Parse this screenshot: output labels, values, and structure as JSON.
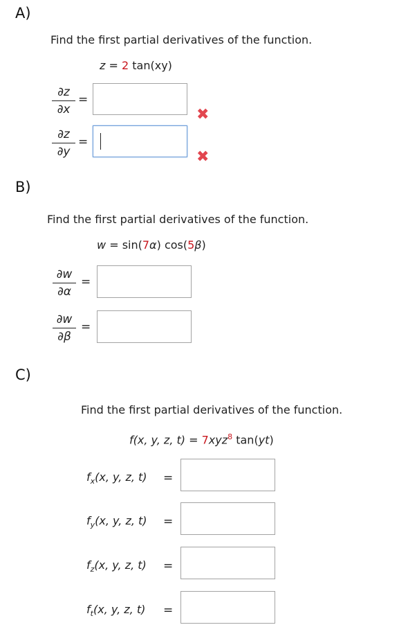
{
  "sectionA": {
    "label": "A)",
    "instruction": "Find the first partial derivatives of the function.",
    "formula": {
      "lhs": "z",
      "eq": "=",
      "coef": "2",
      "rest": "tan(xy)"
    },
    "rows": [
      {
        "num": "∂z",
        "den": "∂x",
        "eq": "=",
        "value": "",
        "status_icon": "cross-icon"
      },
      {
        "num": "∂z",
        "den": "∂y",
        "eq": "=",
        "value": "",
        "status_icon": "cross-icon"
      }
    ]
  },
  "sectionB": {
    "label": "B)",
    "instruction": "Find the first partial derivatives of the function.",
    "formula": {
      "lhs": "w",
      "eq": "=",
      "f1": "sin(",
      "c1": "7",
      "v1": "α",
      "close1": ")",
      "f2": "cos(",
      "c2": "5",
      "v2": "β",
      "close2": ")"
    },
    "rows": [
      {
        "num": "∂w",
        "den": "∂α",
        "eq": "=",
        "value": ""
      },
      {
        "num": "∂w",
        "den": "∂β",
        "eq": "=",
        "value": ""
      }
    ]
  },
  "sectionC": {
    "label": "C)",
    "instruction": "Find the first partial derivatives of the function.",
    "formula": {
      "lhs": "f(x, y, z, t)",
      "eq": "=",
      "coef": "7",
      "vars": "xyz",
      "exp": "8",
      "rest": "tan(",
      "inner": "yt",
      "close": ")"
    },
    "rows": [
      {
        "f": "f",
        "sub": "x",
        "args": "(x, y, z, t)",
        "eq": "=",
        "value": ""
      },
      {
        "f": "f",
        "sub": "y",
        "args": "(x, y, z, t)",
        "eq": "=",
        "value": ""
      },
      {
        "f": "f",
        "sub": "z",
        "args": "(x, y, z, t)",
        "eq": "=",
        "value": ""
      },
      {
        "f": "f",
        "sub": "t",
        "args": "(x, y, z, t)",
        "eq": "=",
        "value": ""
      }
    ]
  },
  "colors": {
    "accent_red": "#c8161d",
    "cross": "#e2464f",
    "active_border": "#6b9bd8"
  }
}
